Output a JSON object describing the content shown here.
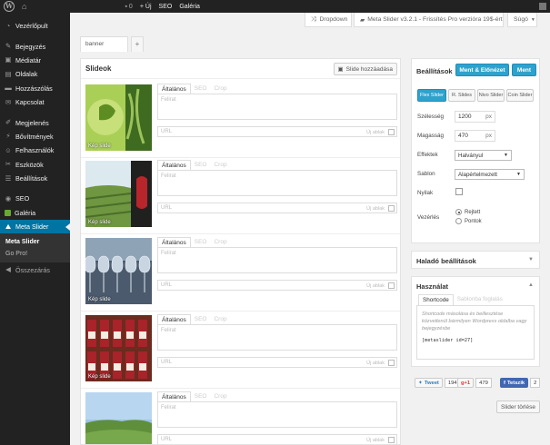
{
  "adminbar": {
    "comments_count": "0",
    "new_label": "Új",
    "seo_label": "SEO",
    "gallery_label": "Galéria"
  },
  "sidebar": {
    "items": [
      {
        "label": "Vezérlőpult",
        "icon": "dashboard-icon"
      },
      {
        "label": "Bejegyzés",
        "icon": "pin-icon"
      },
      {
        "label": "Médiatár",
        "icon": "media-icon"
      },
      {
        "label": "Oldalak",
        "icon": "page-icon"
      },
      {
        "label": "Hozzászólás",
        "icon": "comment-icon"
      },
      {
        "label": "Kapcsolat",
        "icon": "mail-icon"
      },
      {
        "label": "Megjelenés",
        "icon": "brush-icon"
      },
      {
        "label": "Bővítmények",
        "icon": "plugin-icon"
      },
      {
        "label": "Felhasználók",
        "icon": "users-icon"
      },
      {
        "label": "Eszközök",
        "icon": "tools-icon"
      },
      {
        "label": "Beállítások",
        "icon": "settings-icon"
      },
      {
        "label": "SEO",
        "icon": "seo-icon"
      },
      {
        "label": "Galéria",
        "icon": "gallery-icon"
      },
      {
        "label": "Meta Slider",
        "icon": "slider-icon"
      }
    ],
    "submenu": [
      "Meta Slider",
      "Go Pro!"
    ],
    "collapse_label": "Összezárás"
  },
  "top_buttons": {
    "dropdown": "Dropdown",
    "version": "Meta Slider v3.2.1 - Frissítés Pro verzióra 19$-ért",
    "help": "Súgó"
  },
  "tabs": {
    "current": "banner",
    "add": "+"
  },
  "slides": {
    "title": "Slideok",
    "add_button": "Slide hozzáadása",
    "tab_general": "Általános",
    "tab_seo": "SEO",
    "tab_crop": "Crop",
    "caption_placeholder": "Felirat",
    "url_placeholder": "URL",
    "new_tab": "Új ablak",
    "thumb_label": "Kép slide"
  },
  "settings": {
    "title": "Beállítások",
    "save_preview": "Ment & Előnézet",
    "save": "Ment",
    "types": [
      "Flex Slider",
      "R. Slides",
      "Nivo Slider",
      "Coin Slider"
    ],
    "width_label": "Szélesség",
    "width_value": "1200",
    "height_label": "Magasság",
    "height_value": "470",
    "unit": "px",
    "effect_label": "Effektek",
    "effect_value": "Halványul",
    "theme_label": "Sablon",
    "theme_value": "Alapértelmezett",
    "arrows_label": "Nyilak",
    "navigation_label": "Vezérlés",
    "nav_hidden": "Rejtett",
    "nav_dots": "Pontok"
  },
  "advanced": {
    "title": "Haladó beállítások"
  },
  "usage": {
    "title": "Használat",
    "tab_shortcode": "Shortcode",
    "tab_template": "Sablonba foglalás",
    "text": "Shortcode másolása és beillesztése közvetlenül bármilyen Wordpress oldalba vagy bejegyzésbe",
    "code": "[metaslider id=27]"
  },
  "social": {
    "tweet": "Tweet",
    "tweet_count": "194",
    "gplus": "g+1",
    "gplus_count": "479",
    "fb": "Tetszik",
    "fb_count": "2"
  },
  "delete_button": "Slider törlése",
  "colors": {
    "admin_dark": "#222222",
    "accent": "#0074a2",
    "primary_button": "#2ea2cc"
  }
}
